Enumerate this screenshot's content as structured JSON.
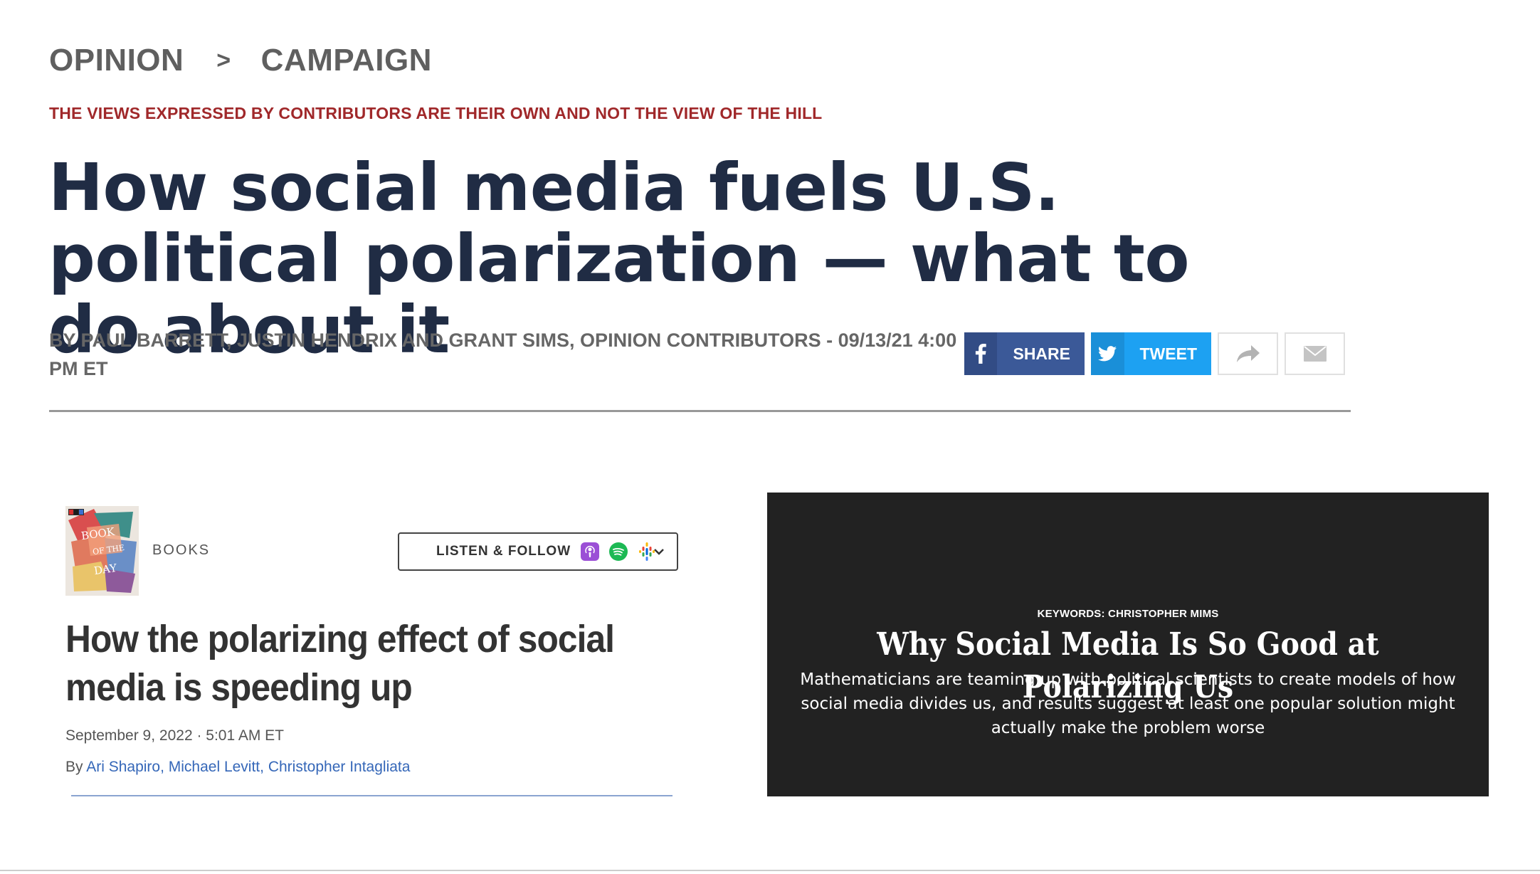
{
  "article": {
    "breadcrumb": {
      "section": "OPINION",
      "separator": ">",
      "subsection": "CAMPAIGN"
    },
    "disclaimer": "THE VIEWS EXPRESSED BY CONTRIBUTORS ARE THEIR OWN AND NOT THE VIEW OF THE HILL",
    "headline": "How social media fuels U.S. political polarization — what to do about it",
    "byline": "BY PAUL BARRETT, JUSTIN HENDRIX AND GRANT SIMS, OPINION CONTRIBUTORS - 09/13/21 4:00 PM ET",
    "share": {
      "facebook_label": "SHARE",
      "twitter_label": "TWEET"
    }
  },
  "npr": {
    "cover": {
      "line1": "BOOK",
      "line2": "OF THE",
      "line3": "DAY",
      "logo": "npr"
    },
    "section": "BOOKS",
    "listen_label": "LISTEN & FOLLOW",
    "title": "How the polarizing effect of social media is speeding up",
    "date": "September 9, 2022 · 5:01 AM ET",
    "by_prefix": "By",
    "authors": "Ari Shapiro, Michael Levitt, Christopher Intagliata"
  },
  "wsj": {
    "keywords": "KEYWORDS: CHRISTOPHER MIMS",
    "title": "Why Social Media Is So Good at Polarizing Us",
    "description": "Mathematicians are teaming up with political scientists to create models of how social media divides us, and results suggest at least one popular solution might actually make the problem worse"
  },
  "colors": {
    "headline": "#202c44",
    "disclaimer": "#a0282a",
    "facebook": "#3b5998",
    "twitter": "#1da1f2",
    "card_bg": "#222222",
    "link": "#3567b8"
  }
}
